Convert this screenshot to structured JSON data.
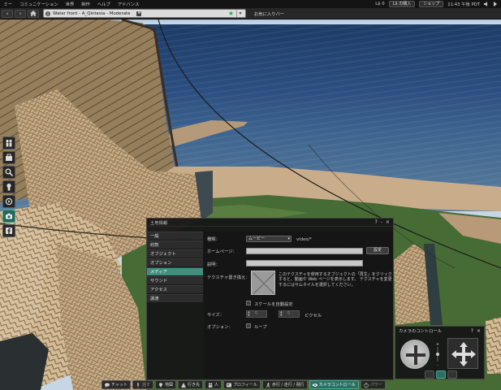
{
  "menubar": {
    "items": [
      "ミー",
      "コミュニケーション",
      "世界",
      "制作",
      "ヘルプ",
      "アドバンス"
    ],
    "balance": "L$ 0",
    "buy_label": "L$ の購入",
    "shop_label": "ショップ",
    "clock": "11:43 午後 PDT"
  },
  "navbar": {
    "location": "Water front - A_Qintesia - Moderate",
    "maturity_badge": "M",
    "favorites_label": "お気に入りバー"
  },
  "left_toolbar": {
    "icons": [
      "people-icon",
      "inventory-icon",
      "search-icon",
      "avatar-icon",
      "appearance-icon",
      "snapshot-icon",
      "facebook-icon"
    ]
  },
  "land_dialog": {
    "title": "土地情報",
    "controls": [
      "?",
      "-",
      "×"
    ],
    "tabs": [
      "一般",
      "約款",
      "オブジェクト",
      "オプション",
      "メディア",
      "サウンド",
      "アクセス",
      "譲渡"
    ],
    "active_tab": "メディア",
    "media": {
      "type_label": "種類：",
      "type_value": "ムービー",
      "type_desc": "video/*",
      "homepage_label": "ホームページ：",
      "set_button": "設定",
      "description_label": "説明：",
      "texture_label": "テクスチャ置き換え：",
      "texture_note": "このテクスチャを使用するオブジェクトの「再生」をクリックすると、動画や Web ページを表示します。 テクスチャを変更するにはサムネイルを選択してください。",
      "autoscale_label": "スケールを自動設定",
      "size_label": "サイズ：",
      "size_w": "0",
      "size_h": "0",
      "size_unit": "ピクセル",
      "options_label": "オプション：",
      "loop_label": "ループ"
    }
  },
  "camera_dialog": {
    "title": "カメラのコントロール",
    "controls": [
      "?",
      "×"
    ]
  },
  "bottom_toolbar": {
    "buttons": [
      {
        "name": "chat",
        "label": "チャット"
      },
      {
        "name": "speak",
        "label": "話す"
      },
      {
        "name": "map",
        "label": "地図"
      },
      {
        "name": "destinations",
        "label": "行き先"
      },
      {
        "name": "people",
        "label": "人"
      },
      {
        "name": "profile",
        "label": "プロフィール"
      },
      {
        "name": "move",
        "label": "歩行 / 走行 / 飛行"
      },
      {
        "name": "camera",
        "label": "カメラコントロール"
      },
      {
        "name": "power",
        "label": "パワー"
      }
    ]
  },
  "colors": {
    "accent": "#3f8f7e",
    "panel": "#161616"
  }
}
